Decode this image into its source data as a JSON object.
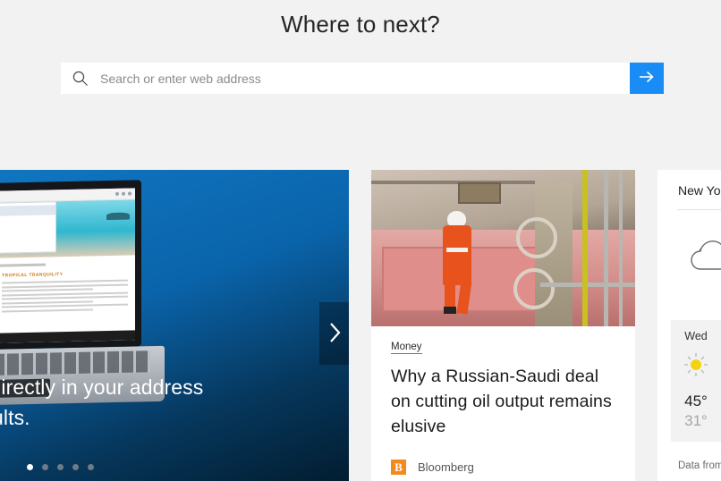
{
  "page": {
    "title": "Where to next?",
    "background_color": "#f2f2f2"
  },
  "search": {
    "placeholder": "Search or enter web address",
    "value": "",
    "icon": "search-icon",
    "go_button_icon": "arrow-right-icon",
    "accent_color": "#1a8cf5"
  },
  "promo_card": {
    "text": "typing directly in your address rch results.",
    "text_line1": "typing directly in your address",
    "text_line2": "rch results.",
    "next_button_icon": "chevron-right-icon",
    "dots_total": 5,
    "dots_active_index": 0,
    "background_color": "#0b6cb5",
    "screen_article_title": "TROPICAL TRANQUILITY"
  },
  "news_card": {
    "category": "Money",
    "headline": "Why a Russian-Saudi deal on cutting oil output remains elusive",
    "source_name": "Bloomberg",
    "source_logo_letter": "B",
    "source_logo_color": "#f28b1c",
    "image_alt": "oil-rig-worker-image"
  },
  "weather_card": {
    "location": "New Yor",
    "current_icon": "cloudy-icon",
    "attribution": "Data from",
    "forecast": [
      {
        "day": "Wed",
        "icon": "sunny-icon",
        "high": "45°",
        "low": "31°"
      }
    ]
  }
}
